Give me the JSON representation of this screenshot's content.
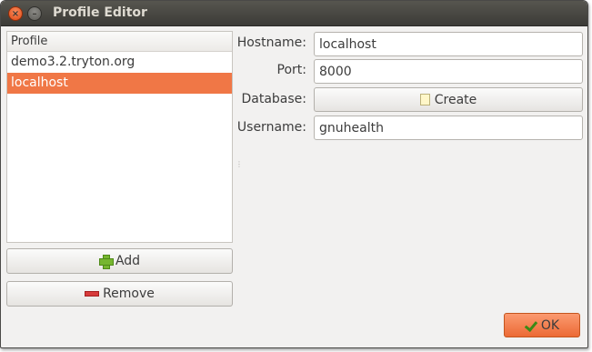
{
  "window": {
    "title": "Profile Editor"
  },
  "profiles": {
    "header": "Profile",
    "items": [
      {
        "label": "demo3.2.tryton.org"
      },
      {
        "label": "localhost"
      }
    ],
    "selected_index": 1
  },
  "buttons": {
    "add": "Add",
    "remove": "Remove",
    "create": "Create",
    "ok": "OK"
  },
  "form": {
    "hostname_label": "Hostname:",
    "hostname_value": "localhost",
    "port_label": "Port:",
    "port_value": "8000",
    "database_label": "Database:",
    "username_label": "Username:",
    "username_value": "gnuhealth"
  },
  "icons": {
    "add": "plus-icon",
    "remove": "minus-icon",
    "create": "new-page-icon",
    "ok": "check-icon",
    "close": "close-icon",
    "minimize": "minimize-icon"
  },
  "colors": {
    "selection": "#f07746",
    "titlebar": "#3c3b37",
    "window_bg": "#f2f1f0"
  }
}
